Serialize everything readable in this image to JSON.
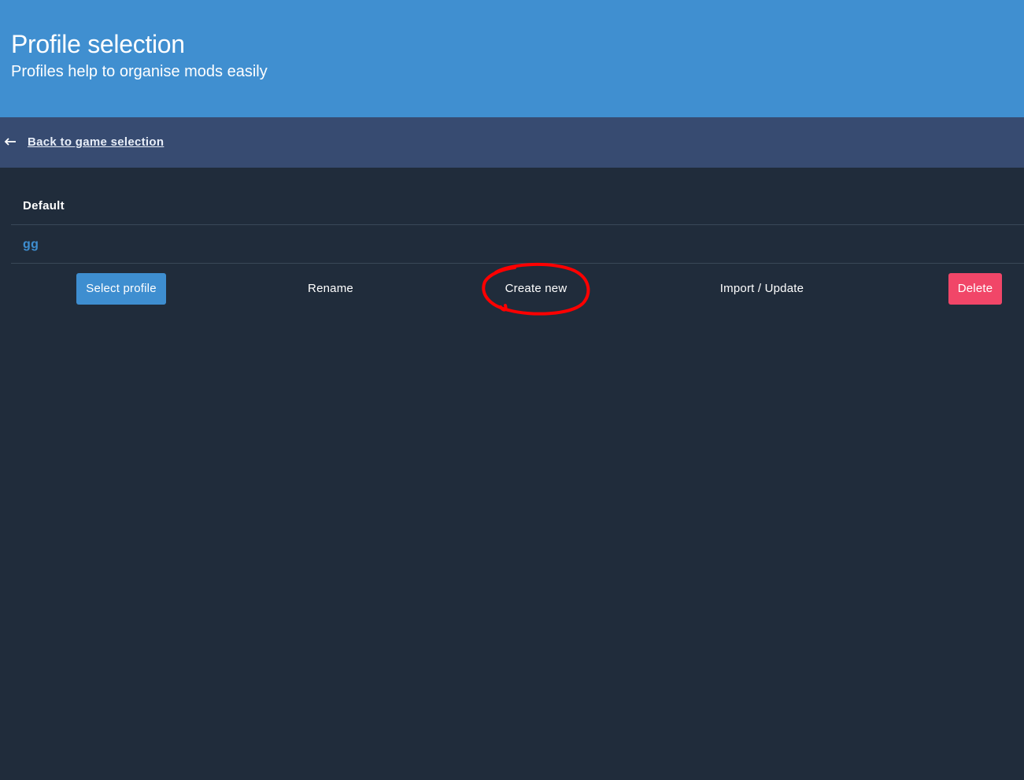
{
  "header": {
    "title": "Profile selection",
    "subtitle": "Profiles help to organise mods easily"
  },
  "navigation": {
    "back_link": "Back to game selection",
    "back_icon": "arrow-left-icon"
  },
  "profiles": [
    {
      "name": "Default"
    },
    {
      "name": "gg",
      "selected": true
    }
  ],
  "actions": {
    "select": "Select profile",
    "rename": "Rename",
    "create": "Create new",
    "import": "Import / Update",
    "delete": "Delete"
  },
  "colors": {
    "hero": "#408fd0",
    "nav": "#374b71",
    "background": "#202c3b",
    "primary": "#3e8ed0",
    "danger": "#f14668",
    "annotation": "#ff0000"
  }
}
